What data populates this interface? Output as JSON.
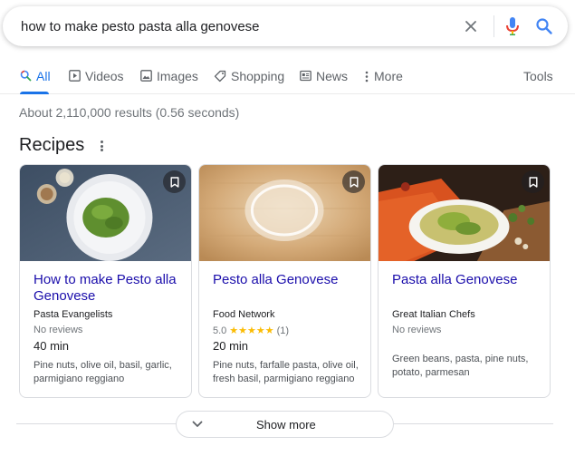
{
  "search": {
    "query": "how to make pesto pasta alla genovese"
  },
  "tabs": [
    {
      "label": "All",
      "icon": "search-icon",
      "active": true
    },
    {
      "label": "Videos",
      "icon": "play-icon"
    },
    {
      "label": "Images",
      "icon": "image-icon"
    },
    {
      "label": "Shopping",
      "icon": "tag-icon"
    },
    {
      "label": "News",
      "icon": "newspaper-icon"
    },
    {
      "label": "More",
      "icon": "kebab-icon"
    }
  ],
  "tools_label": "Tools",
  "result_stats": "About 2,110,000 results (0.56 seconds)",
  "recipes": {
    "title": "Recipes",
    "cards": [
      {
        "title": "How to make Pesto alla Genovese",
        "source": "Pasta Evangelists",
        "reviews": "No reviews",
        "time": "40 min",
        "ingredients": "Pine nuts, olive oil, basil, garlic, parmigiano reggiano"
      },
      {
        "title": "Pesto alla Genovese",
        "source": "Food Network",
        "rating_value": "5.0",
        "rating_stars": "★★★★★",
        "rating_count": "(1)",
        "time": "20 min",
        "ingredients": "Pine nuts, farfalle pasta, olive oil, fresh basil, parmigiano reggiano"
      },
      {
        "title": "Pasta alla Genovese",
        "source": "Great Italian Chefs",
        "reviews": "No reviews",
        "ingredients": "Green beans, pasta, pine nuts, potato, parmesan"
      }
    ]
  },
  "show_more_label": "Show more",
  "colors": {
    "link": "#1a0dab",
    "accent": "#1a73e8",
    "star": "#fbbc04",
    "muted": "#70757a"
  }
}
